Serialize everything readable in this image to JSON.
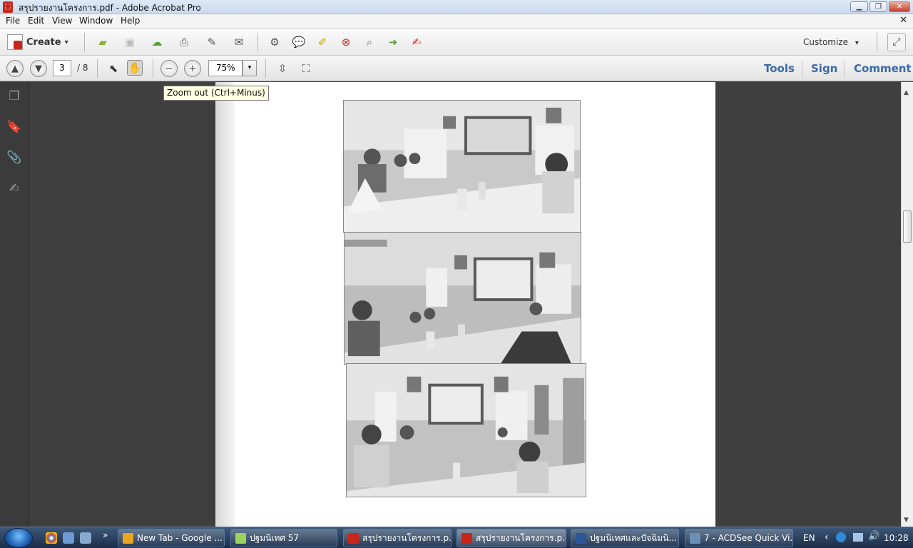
{
  "window": {
    "title": "สรุปรายงานโครงการ.pdf - Adobe Acrobat Pro",
    "minimize": "▁",
    "restore": "❐",
    "close": "✕"
  },
  "menu": {
    "items": [
      "File",
      "Edit",
      "View",
      "Window",
      "Help"
    ],
    "close": "✕"
  },
  "toolbar": {
    "create_label": "Create",
    "create_caret": "▾",
    "customize_label": "Customize",
    "customize_caret": "▾",
    "icons": [
      "open-folder-icon",
      "save-icon",
      "cloud-upload-icon",
      "print-icon",
      "edit-document-icon",
      "email-icon",
      "gear-icon",
      "comment-bubble-icon",
      "highlight-icon",
      "delete-page-icon",
      "search-page-icon",
      "export-icon",
      "sign-document-icon"
    ]
  },
  "navbar": {
    "current_page": "3",
    "total_pages": "/ 8",
    "zoom": "75%",
    "zoom_caret": "▾",
    "tabs": [
      "Tools",
      "Sign",
      "Comment"
    ]
  },
  "tooltip": {
    "text": "Zoom out (Ctrl+Minus)"
  },
  "taskbar": {
    "tasks": [
      {
        "label": "New Tab - Google ...",
        "icon_color": "#e8a620"
      },
      {
        "label": "ปฐมนิเทศ 57",
        "icon_color": "#9bd35a"
      },
      {
        "label": "สรุปรายงานโครงการ.p...",
        "icon_color": "#c8261b"
      },
      {
        "label": "สรุปรายงานโครงการ.p...",
        "icon_color": "#c8261b"
      },
      {
        "label": "ปฐมนิเทศและปัจฉิมนิ...",
        "icon_color": "#2b5797"
      },
      {
        "label": "7 - ACDSee Quick Vi...",
        "icon_color": "#6b8fb3"
      }
    ],
    "show_more": "»",
    "lang": "EN",
    "tray_arrow": "‹",
    "clock": "10:28"
  },
  "colors": {
    "accent_blue": "#3a6aa8",
    "acrobat_red": "#c8261b",
    "doc_background": "#3f3f3f"
  }
}
